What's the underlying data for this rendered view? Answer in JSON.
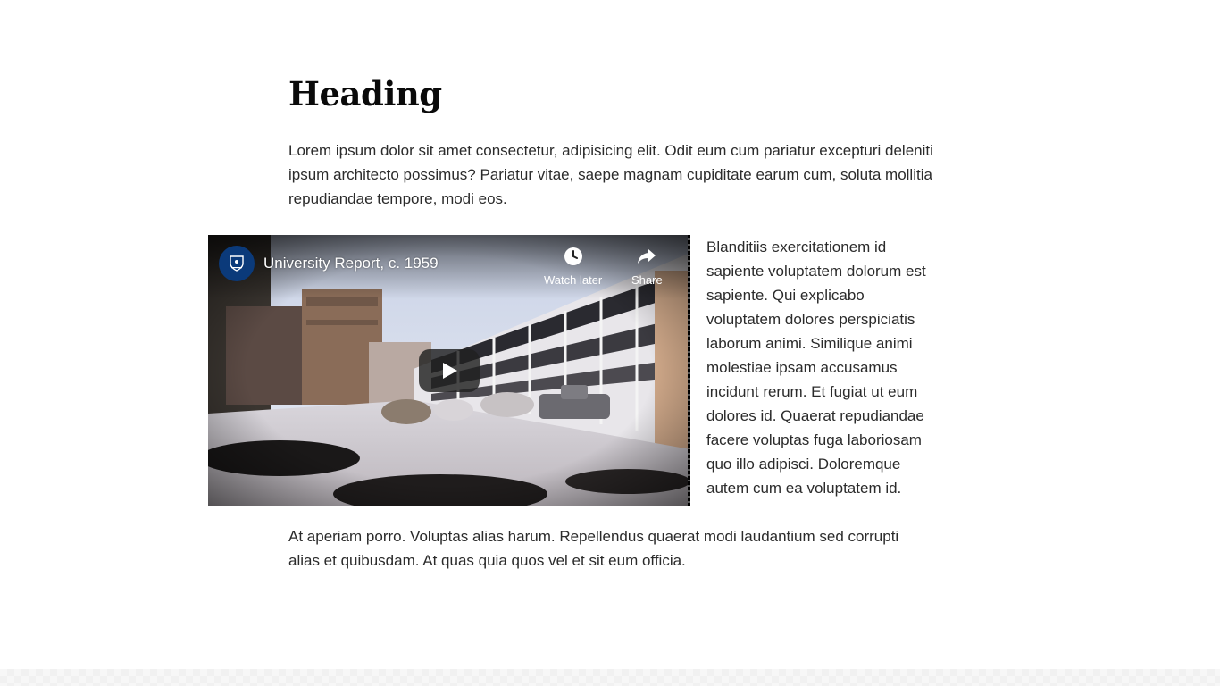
{
  "article": {
    "heading": "Heading",
    "paragraph_1": "Lorem ipsum dolor sit amet consectetur, adipisicing elit. Odit eum cum pariatur excepturi deleniti ipsum architecto possimus? Pariatur vitae, saepe magnam cupiditate earum cum, soluta mollitia repudiandae tempore, modi eos.",
    "side_paragraph": "Blanditiis exercitationem id sapiente voluptatem dolorum est sapiente. Qui explicabo voluptatem dolores perspiciatis laborum animi. Similique animi molestiae ipsam accusamus incidunt rerum. Et fugiat ut eum dolores id. Quaerat repudiandae facere voluptas fuga laboriosam quo illo adipisci. Doloremque autem cum ea voluptatem id.",
    "paragraph_3": "At aperiam porro. Voluptas alias harum. Repellendus quaerat modi laudantium sed corrupti alias et quibusdam. At quas quia quos vel et sit eum officia."
  },
  "video": {
    "title": "University Report, c. 1959",
    "watch_later_label": "Watch later",
    "share_label": "Share",
    "icons": {
      "channel": "university-crest-icon",
      "watch_later": "clock-icon",
      "share": "share-arrow-icon",
      "play": "play-icon"
    }
  },
  "colors": {
    "heading": "#0a0a0a",
    "body_text": "#2b2b2b",
    "channel_avatar": "#0b3a7a",
    "play_button": "#212121"
  }
}
